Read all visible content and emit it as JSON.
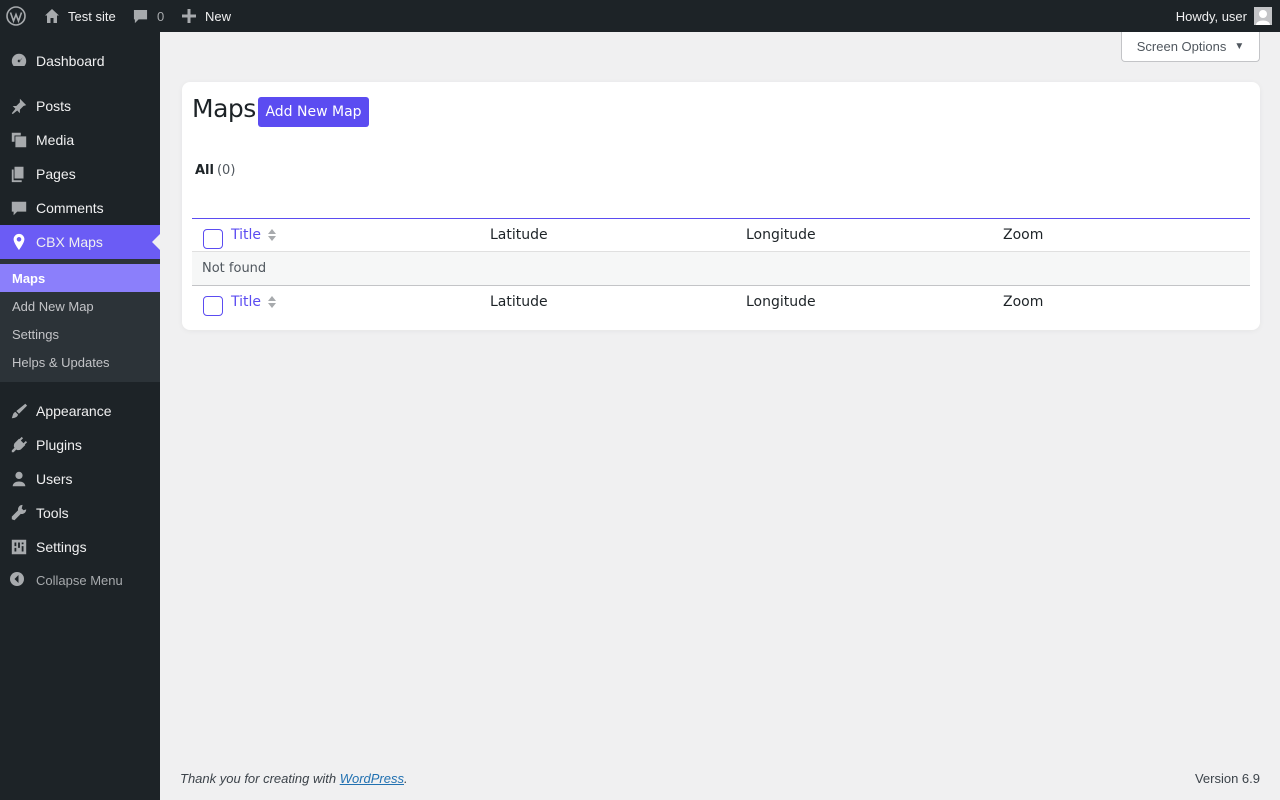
{
  "adminbar": {
    "site_name": "Test site",
    "comments_count": "0",
    "new_label": "New",
    "account_label": "Howdy, user"
  },
  "sidebar": {
    "items": [
      {
        "label": "Dashboard",
        "icon": "dashboard-icon"
      },
      {
        "label": "Posts",
        "icon": "pin-icon"
      },
      {
        "label": "Media",
        "icon": "media-icon"
      },
      {
        "label": "Pages",
        "icon": "pages-icon"
      },
      {
        "label": "Comments",
        "icon": "comment-icon"
      },
      {
        "label": "CBX Maps",
        "icon": "location-pin-icon"
      },
      {
        "label": "Appearance",
        "icon": "paintbrush-icon"
      },
      {
        "label": "Plugins",
        "icon": "plug-icon"
      },
      {
        "label": "Users",
        "icon": "user-icon"
      },
      {
        "label": "Tools",
        "icon": "wrench-icon"
      },
      {
        "label": "Settings",
        "icon": "settings-icon"
      }
    ],
    "submenu": [
      "Maps",
      "Add New Map",
      "Settings",
      "Helps & Updates"
    ],
    "collapse_label": "Collapse Menu"
  },
  "screen_options": {
    "label": "Screen Options"
  },
  "main": {
    "title": "Maps",
    "add_button": "Add New Map",
    "filter_all": "All",
    "filter_count": "(0)",
    "columns": [
      "Title",
      "Latitude",
      "Longitude",
      "Zoom"
    ],
    "empty_message": "Not found"
  },
  "footer": {
    "thanks_prefix": "Thank you for creating with ",
    "thanks_link": "WordPress",
    "thanks_suffix": ".",
    "version": "Version 6.9"
  },
  "colors": {
    "accent": "#5b4cf1",
    "active_menu": "#6b5cf5",
    "admin_bg": "#1d2327"
  }
}
